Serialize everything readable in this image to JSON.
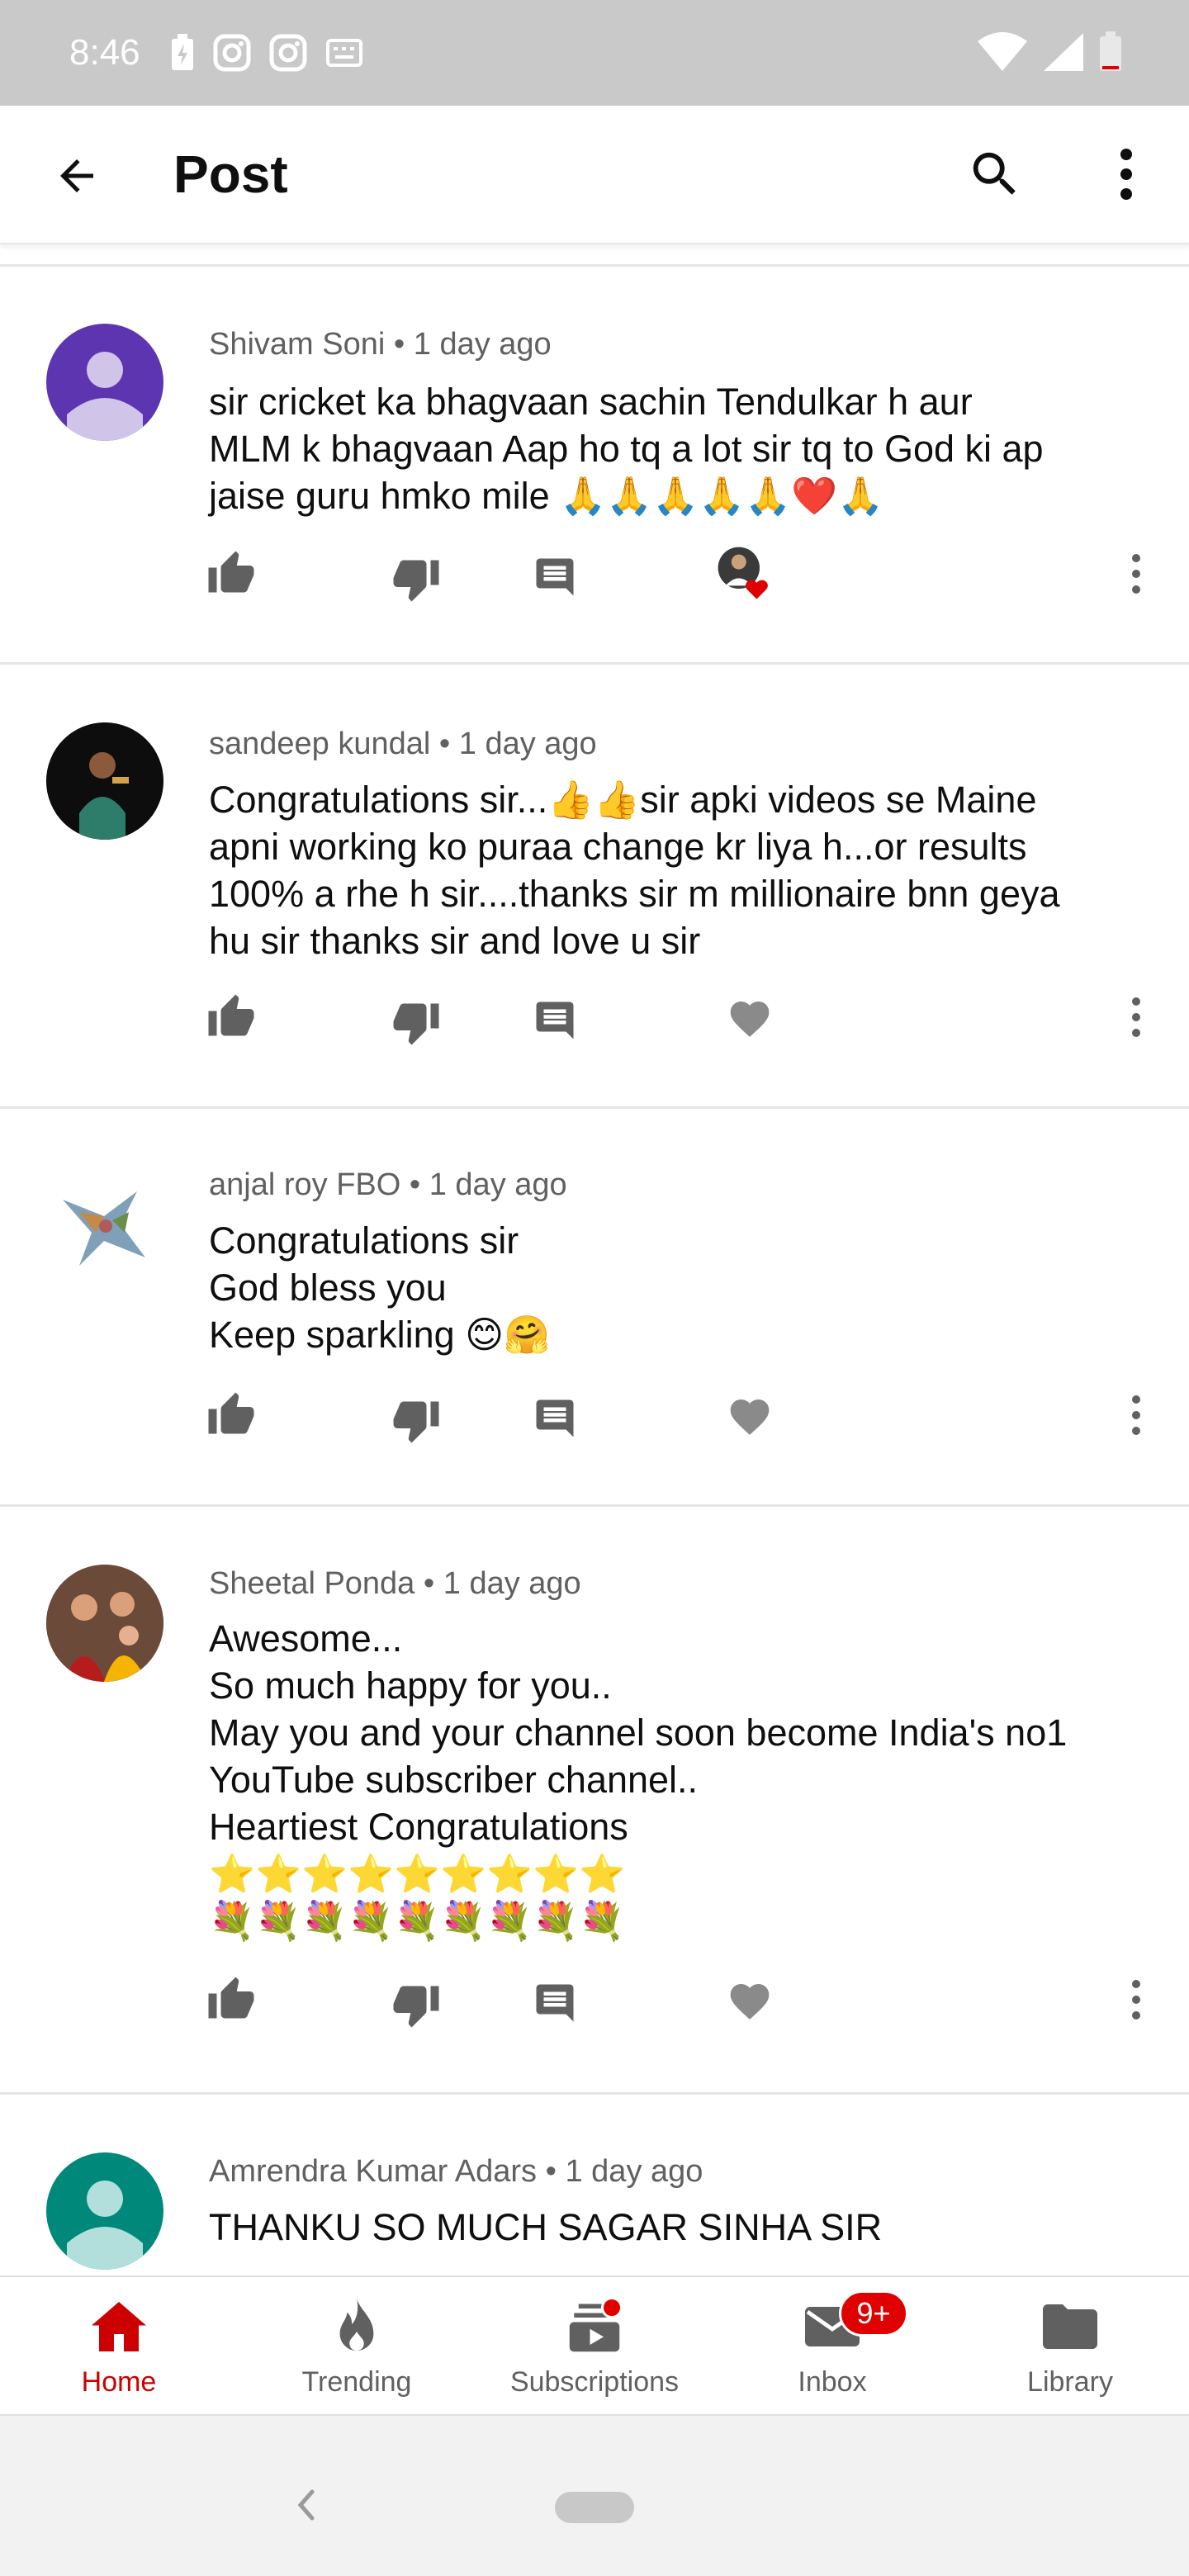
{
  "status_bar": {
    "time": "8:46",
    "icons": [
      "battery-charging-icon",
      "instagram-icon",
      "instagram-icon",
      "keyboard-icon"
    ],
    "right_icons": [
      "wifi-icon",
      "signal-icon",
      "battery-low-icon"
    ]
  },
  "app_bar": {
    "title": "Post"
  },
  "comments": [
    {
      "author": "Shivam Soni",
      "time": "1 day ago",
      "text": "sir cricket ka bhagvaan sachin Tendulkar h aur\nMLM k bhagvaan Aap ho tq a lot sir tq to God ki ap\njaise guru hmko mile 🙏🙏🙏🙏🙏❤️🙏",
      "hearted_by_creator": true,
      "avatar_color": "#5e35b1"
    },
    {
      "author": "sandeep kundal",
      "time": "1 day ago",
      "text": "Congratulations sir...👍👍sir apki videos se Maine\napni working ko puraa change kr liya h...or results\n100% a rhe h sir....thanks sir m millionaire bnn geya\nhu sir thanks sir and love u sir",
      "hearted_by_creator": false,
      "avatar_color": "#111111"
    },
    {
      "author": "anjal roy FBO",
      "time": "1 day ago",
      "text": "Congratulations sir\nGod bless you\nKeep sparkling 😊🤗",
      "hearted_by_creator": false,
      "avatar_color": "#ffffff"
    },
    {
      "author": "Sheetal Ponda",
      "time": "1 day ago",
      "text": "Awesome...\nSo much happy for you..\nMay you and your channel soon become India's no1\nYouTube subscriber channel..\nHeartiest Congratulations\n⭐⭐⭐⭐⭐⭐⭐⭐⭐\n💐💐💐💐💐💐💐💐💐",
      "hearted_by_creator": false,
      "avatar_color": "#7a4a3a"
    },
    {
      "author": "Amrendra Kumar Adars",
      "time": "1 day ago",
      "text": "THANKU SO MUCH SAGAR SINHA SIR",
      "hearted_by_creator": false,
      "avatar_color": "#00897b"
    }
  ],
  "bottom_nav": {
    "items": [
      {
        "label": "Home",
        "icon": "home-icon",
        "active": true
      },
      {
        "label": "Trending",
        "icon": "flame-icon",
        "active": false
      },
      {
        "label": "Subscriptions",
        "icon": "subscriptions-icon",
        "active": false
      },
      {
        "label": "Inbox",
        "icon": "inbox-icon",
        "active": false,
        "badge": "9+"
      },
      {
        "label": "Library",
        "icon": "folder-icon",
        "active": false
      }
    ]
  },
  "colors": {
    "accent": "#cc0000",
    "badge": "#e00000",
    "icon_gray": "#606060"
  }
}
